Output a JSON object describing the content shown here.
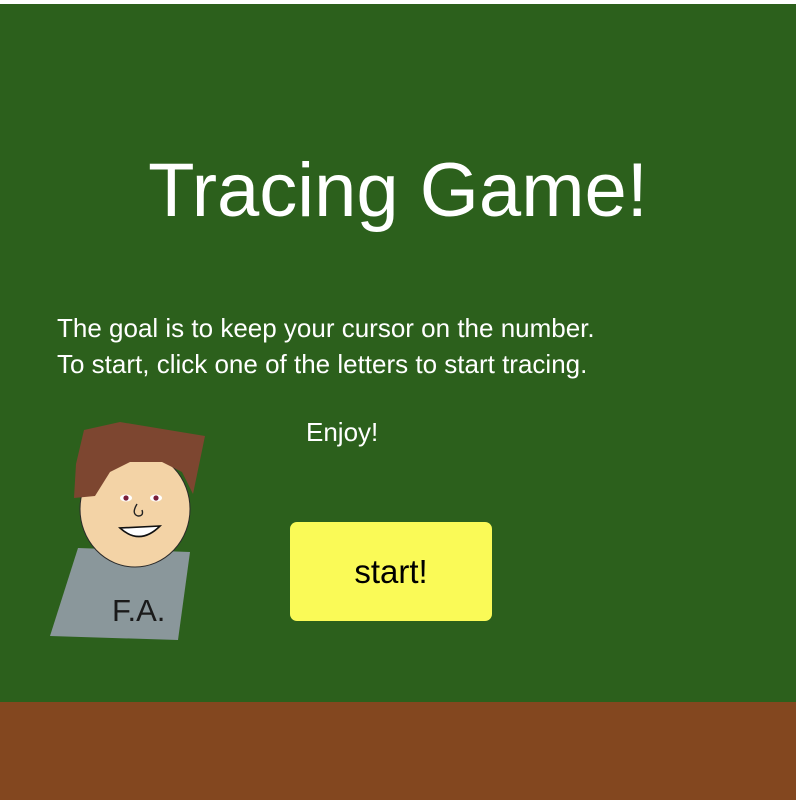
{
  "game": {
    "title": "Tracing Game!",
    "instructions": [
      "The goal is to keep your cursor on the number.",
      "To start, click one of the letters to start tracing."
    ],
    "enjoy_text": "Enjoy!",
    "start_button_label": "start!",
    "character_initials": "F.A."
  },
  "colors": {
    "board": "#2C601C",
    "ground": "#83471F",
    "button": "#FAFA57",
    "text": "#FFFFFF",
    "hair": "#7D4630",
    "skin": "#F3D3A6",
    "shirt": "#8A979B",
    "eye": "#7A1F3A"
  },
  "icons": {
    "character": "cartoon-character-icon"
  }
}
